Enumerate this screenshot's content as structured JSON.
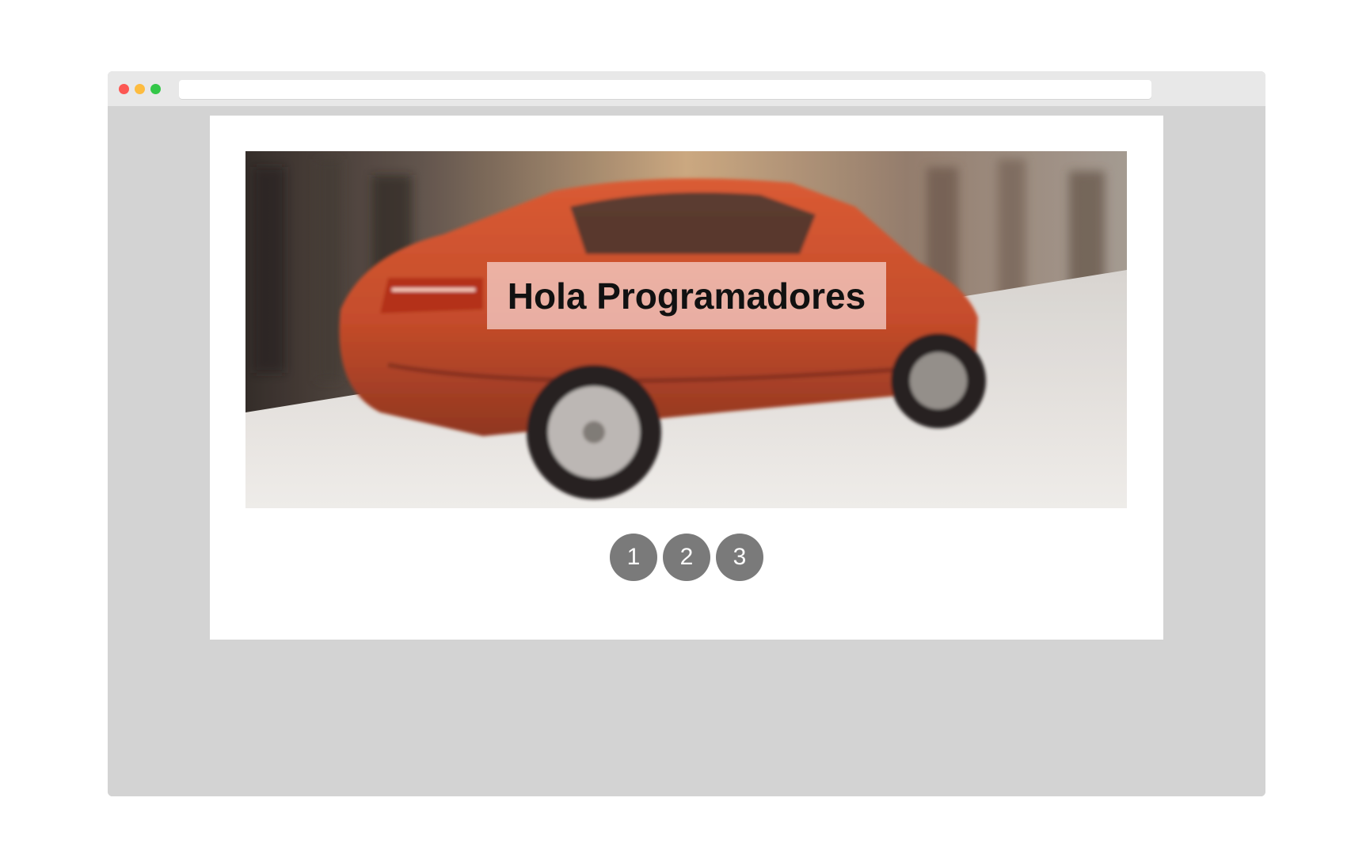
{
  "browser": {
    "address": ""
  },
  "slider": {
    "caption": "Hola Programadores",
    "image_icon": "red-suv-photo"
  },
  "pagination": {
    "pages": [
      "1",
      "2",
      "3"
    ]
  },
  "colors": {
    "window_bg": "#d3d3d3",
    "titlebar_bg": "#e8e8e8",
    "dot_red": "#fc5753",
    "dot_yellow": "#fdbc40",
    "dot_green": "#33c748",
    "pagination_dot": "#7a7a7a"
  }
}
